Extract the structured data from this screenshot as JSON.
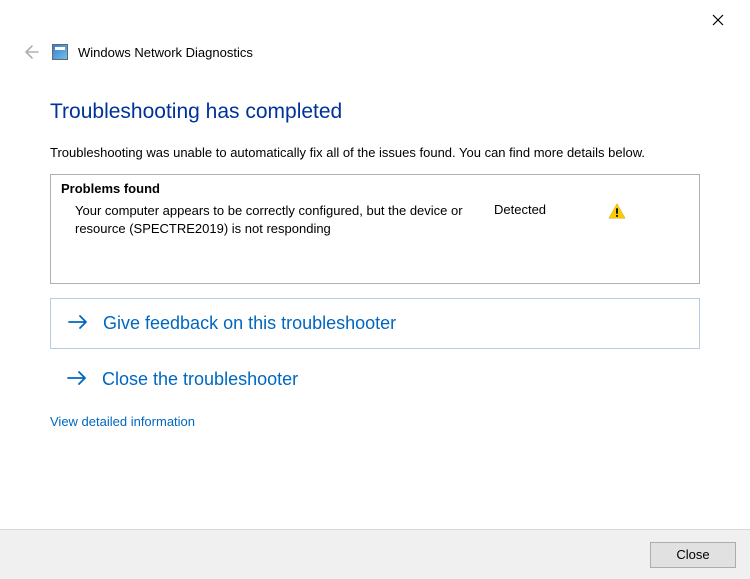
{
  "header": {
    "title": "Windows Network Diagnostics"
  },
  "main": {
    "heading": "Troubleshooting has completed",
    "subtext": "Troubleshooting was unable to automatically fix all of the issues found. You can find more details below."
  },
  "problems": {
    "title": "Problems found",
    "items": [
      {
        "desc": "Your computer appears to be correctly configured, but the device or resource (SPECTRE2019) is not responding",
        "status": "Detected"
      }
    ]
  },
  "options": {
    "feedback": "Give feedback on this troubleshooter",
    "close": "Close the troubleshooter"
  },
  "links": {
    "detail": "View detailed information"
  },
  "footer": {
    "close_label": "Close"
  }
}
